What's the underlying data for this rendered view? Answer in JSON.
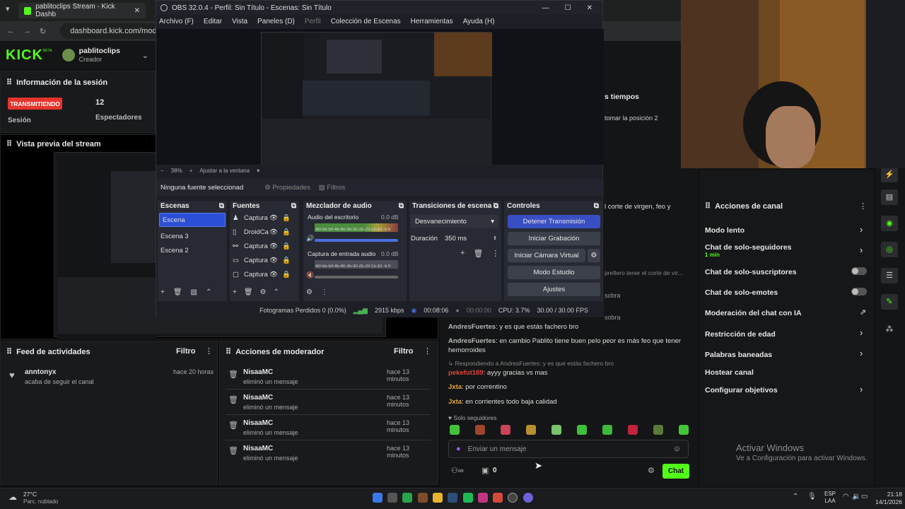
{
  "browser": {
    "tab_title": "pablitoclips Stream - Kick Dashb",
    "url": "dashboard.kick.com/moder"
  },
  "kick": {
    "logo": "KICK",
    "logo_sup": "BETA",
    "user": "pablitoclips",
    "role": "Creador",
    "session": {
      "title": "Información de la sesión",
      "status": "TRANSMITIENDO",
      "session_label": "Sesión",
      "viewers_value": "12",
      "viewers_label": "Espectadores"
    },
    "preview_title": "Vista previa del stream",
    "activity": {
      "title": "Feed de actividades",
      "filter": "Filtro",
      "items": [
        {
          "user": "anntonyx",
          "text": "acaba de seguir el canal",
          "time": "hace 20 horas"
        }
      ]
    },
    "mod": {
      "title": "Acciones de moderador",
      "filter": "Filtro",
      "items": [
        {
          "user": "NisaaMC",
          "text": "eliminó un mensaje",
          "time": "hace 13 minutos"
        },
        {
          "user": "NisaaMC",
          "text": "eliminó un mensaje",
          "time": "hace 13 minutos"
        },
        {
          "user": "NisaaMC",
          "text": "eliminó un mensaje",
          "time": "hace 13 minutos"
        },
        {
          "user": "NisaaMC",
          "text": "eliminó un mensaje",
          "time": "hace 13 minutos"
        }
      ]
    },
    "partial": {
      "tiempos": "s tiempos",
      "posicion": "tomar la posición 2",
      "corte": "l corte de virgen, feo y",
      "prefiero": "prefiero tener el corte de vir...",
      "sobra1": "sobra",
      "sobra2": "sobra"
    },
    "chat": {
      "messages": [
        {
          "user": "AndresFuertes",
          "text": ": y es que estás fachero bro"
        },
        {
          "user": "AndresFuertes",
          "text": ": en cambio Pablito tiene buen pelo peor es más feo que tener hemorroides"
        },
        {
          "reply": "Respondiendo a AndresFuertes: y es que estás fachero bro"
        },
        {
          "user": "pekefut189",
          "text": ": ayyy gracias vs mas"
        },
        {
          "user": "Jxta",
          "text": ": por correntino"
        },
        {
          "user": "Jxta",
          "text": ": en corrientes todo baja calidad"
        }
      ],
      "followers_only": "Solo seguidores",
      "placeholder": "Enviar un mensaje",
      "count": "0",
      "send": "Chat"
    },
    "actions": {
      "title": "Acciones de canal",
      "items": [
        {
          "label": "Modo lento"
        },
        {
          "label": "Chat de solo-seguidores",
          "sub": "1 min"
        },
        {
          "label": "Chat de solo-suscriptores"
        },
        {
          "label": "Chat de solo-emotes"
        },
        {
          "label": "Moderación del chat con IA"
        },
        {
          "label": "Restricción de edad"
        },
        {
          "label": "Palabras baneadas"
        },
        {
          "label": "Hostear canal"
        },
        {
          "label": "Configurar objetivos"
        }
      ]
    },
    "activate": {
      "title": "Activar Windows",
      "subtitle": "Ve a Configuración para activar Windows."
    }
  },
  "obs": {
    "title": "OBS 32.0.4 - Perfil: Sin Título - Escenas: Sin Título",
    "menu": [
      "Archivo (F)",
      "Editar",
      "Vista",
      "Paneles (D)",
      "Perfil",
      "Colección de Escenas",
      "Herramientas",
      "Ayuda (H)"
    ],
    "zoom": "38%",
    "fit": "Ajustar a la ventana",
    "no_source": "Ninguna fuente seleccionad",
    "properties": "Propiedades",
    "filters": "Filtros",
    "scenes": {
      "title": "Escenas",
      "items": [
        "Escena",
        "Escena 3",
        "Escena 2"
      ]
    },
    "sources": {
      "title": "Fuentes",
      "items": [
        "Captura",
        "DroidCa",
        "Captura",
        "Captura",
        "Captura"
      ]
    },
    "mixer": {
      "title": "Mezclador de audio",
      "ch1": "Audio del escritorio",
      "ch1_db": "0.0 dB",
      "ch2": "Captura de entrada audio",
      "ch2_db": "0.0 dB",
      "scale": "-60-55-50-45-40-35-30-25-20-15-10 -5  0"
    },
    "transitions": {
      "title": "Transiciones de escena",
      "type": "Desvanecimiento",
      "duration_label": "Duración",
      "duration": "350 ms"
    },
    "controls": {
      "title": "Controles",
      "stop": "Detener Transmisión",
      "record": "Iniciar Grabación",
      "vcam": "Iniciar Cámara Virtual",
      "studio": "Modo Estudio",
      "settings": "Ajustes"
    },
    "status": {
      "dropped": "Fotogramas Perdidos 0 (0.0%)",
      "kbps": "2915 kbps",
      "live_time": "00:08:06",
      "rec_time": "00:00:00",
      "cpu": "CPU: 3.7%",
      "fps": "30.00 / 30.00 FPS"
    }
  },
  "taskbar": {
    "temp": "27°C",
    "weather": "Parc. nublado",
    "lang1": "ESP",
    "lang2": "LAA",
    "time": "21:18",
    "date": "14/1/2026"
  },
  "colors": {
    "kick_green": "#53fc18",
    "live_red": "#e5342b",
    "obs_blue": "#3a4ec4"
  }
}
